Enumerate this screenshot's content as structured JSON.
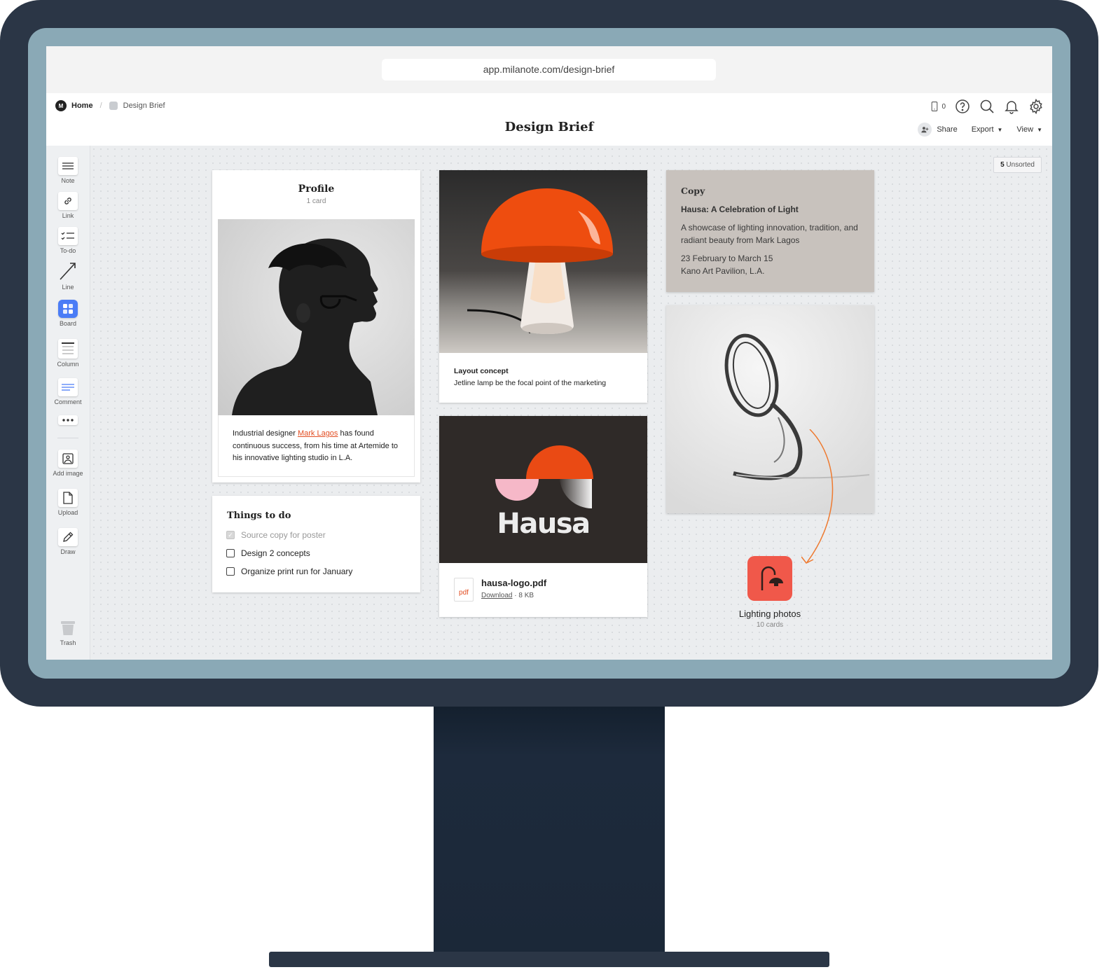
{
  "browser": {
    "url": "app.milanote.com/design-brief"
  },
  "breadcrumb": {
    "home": "Home",
    "current": "Design Brief"
  },
  "header": {
    "title": "Design Brief",
    "device_count": "0",
    "share_label": "Share",
    "export_label": "Export",
    "view_label": "View"
  },
  "toolbar": {
    "items": [
      {
        "label": "Note",
        "icon": "note-icon"
      },
      {
        "label": "Link",
        "icon": "link-icon"
      },
      {
        "label": "To-do",
        "icon": "todo-icon"
      },
      {
        "label": "Line",
        "icon": "line-icon"
      },
      {
        "label": "Board",
        "icon": "board-icon"
      },
      {
        "label": "Column",
        "icon": "column-icon"
      },
      {
        "label": "Comment",
        "icon": "comment-icon"
      },
      {
        "label": "",
        "icon": "more-icon"
      },
      {
        "label": "Add image",
        "icon": "add-image-icon"
      },
      {
        "label": "Upload",
        "icon": "upload-icon"
      },
      {
        "label": "Draw",
        "icon": "draw-icon"
      },
      {
        "label": "Trash",
        "icon": "trash-icon"
      }
    ]
  },
  "unsorted": {
    "count": "5",
    "label": "Unsorted"
  },
  "profile": {
    "title": "Profile",
    "subtitle": "1 card",
    "text_before": "Industrial designer ",
    "link": "Mark Lagos",
    "text_after": " has found continuous success, from his time at Artemide to his innovative lighting studio in L.A."
  },
  "todo": {
    "title": "Things to do",
    "items": [
      {
        "label": "Source copy for poster",
        "done": true
      },
      {
        "label": "Design 2 concepts",
        "done": false
      },
      {
        "label": "Organize print run for January",
        "done": false
      }
    ]
  },
  "layout_card": {
    "title": "Layout concept",
    "text": "Jetline lamp be the focal point of the marketing"
  },
  "file_card": {
    "logo_word": "Hausa",
    "icon_label": "pdf",
    "filename": "hausa-logo.pdf",
    "download_label": "Download",
    "size": "8 KB"
  },
  "copy_card": {
    "label": "Copy",
    "heading": "Hausa: A Celebration of Light",
    "body": "A showcase of lighting innovation, tradition, and radiant beauty from Mark Lagos",
    "dates": "23 February to March 15",
    "venue": "Kano Art Pavilion, L.A."
  },
  "board_link": {
    "name": "Lighting photos",
    "count": "10 cards"
  },
  "colors": {
    "accent_orange": "#e24e23",
    "board_tile": "#f0584a",
    "board_tool": "#4a7cf6",
    "copy_card_bg": "#c8c2bd",
    "monitor_frame": "#2b3646"
  }
}
